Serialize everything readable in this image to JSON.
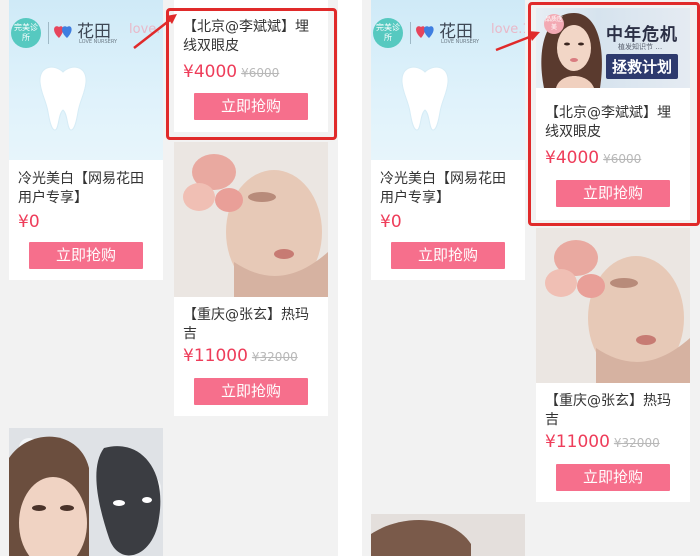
{
  "left_panel": {
    "card_tooth": {
      "logo": {
        "bubble_text": "完美诊所",
        "brand": "花田",
        "brand_sub": "LOVE NURSERY",
        "tagline": "love."
      },
      "title": "冷光美白【网易花田用户专享】",
      "price": "¥0",
      "buy_label": "立即抢购"
    },
    "card_eyelid": {
      "title": "【北京@李斌斌】埋线双眼皮",
      "price": "¥4000",
      "original_price": "¥6000",
      "buy_label": "立即抢购"
    },
    "card_face": {
      "title": "【重庆@张玄】热玛吉",
      "price": "¥11000",
      "original_price": "¥32000",
      "buy_label": "立即抢购"
    }
  },
  "right_panel": {
    "card_tooth": {
      "logo": {
        "bubble_text": "完美诊所",
        "brand": "花田",
        "brand_sub": "LOVE NURSERY",
        "tagline": "love.1"
      },
      "title": "冷光美白【网易花田用户专享】",
      "price": "¥0",
      "buy_label": "立即抢购"
    },
    "card_eyelid": {
      "promo": {
        "badge": "品质医美",
        "headline": "中年危机",
        "subline": "植发知识节 …",
        "banner": "拯救计划"
      },
      "title": "【北京@李斌斌】埋线双眼皮",
      "price": "¥4000",
      "original_price": "¥6000",
      "buy_label": "立即抢购"
    },
    "card_face": {
      "title": "【重庆@张玄】热玛吉",
      "price": "¥11000",
      "original_price": "¥32000",
      "buy_label": "立即抢购"
    }
  },
  "colors": {
    "price": "#ee3d5a",
    "button": "#f66f8c",
    "annotation": "#e02a2a",
    "background": "#f2f2f2"
  }
}
